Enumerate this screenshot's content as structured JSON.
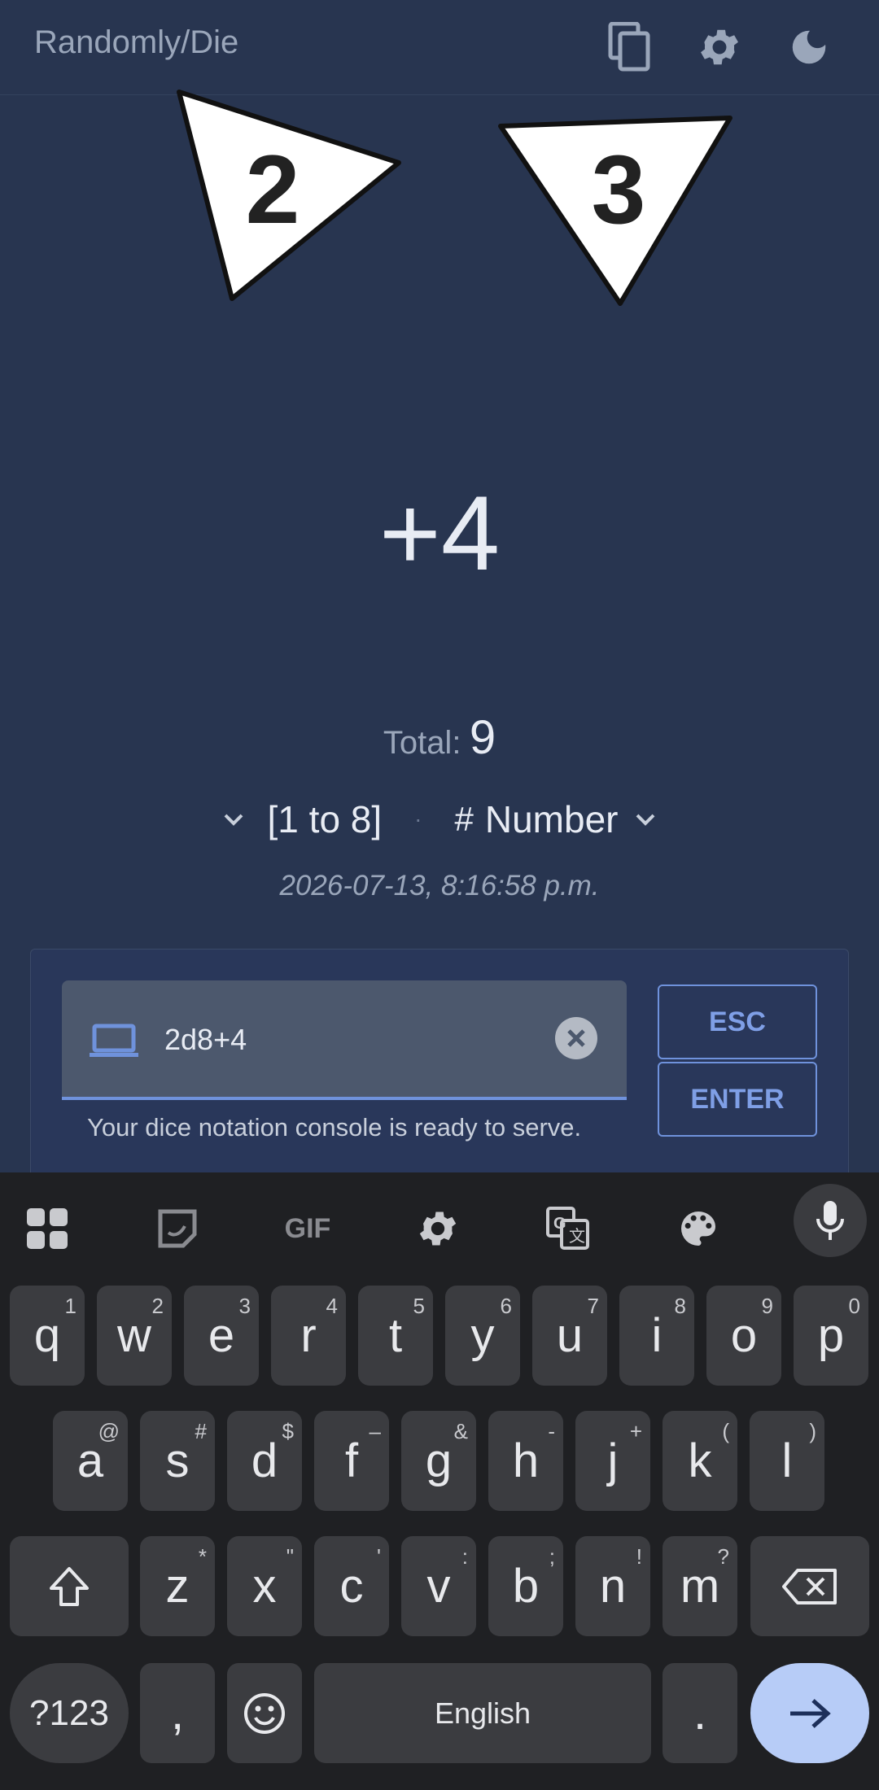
{
  "appbar": {
    "title": "Randomly/Die",
    "icons": [
      "copy-icon",
      "settings-icon",
      "dark-mode-icon"
    ]
  },
  "dice": [
    {
      "value": "2",
      "shape": "triangle-right"
    },
    {
      "value": "3",
      "shape": "triangle-down"
    }
  ],
  "result": "+4",
  "total": {
    "label": "Total:",
    "value": "9"
  },
  "options": {
    "range": "[1 to 8]",
    "separator": "·",
    "mode_icon": "#",
    "mode": "Number"
  },
  "timestamp": "2026-07-13, 8:16:58 p.m.",
  "console": {
    "input_value": "2d8+4",
    "helper": "Your dice notation console is ready to serve.",
    "esc_label": "ESC",
    "enter_label": "ENTER"
  },
  "keyboard": {
    "toolbar": [
      "apps-icon",
      "sticker-icon",
      "GIF",
      "settings-icon",
      "translate-icon",
      "palette-icon",
      "mic-icon"
    ],
    "row1": [
      {
        "k": "q",
        "s": "1"
      },
      {
        "k": "w",
        "s": "2"
      },
      {
        "k": "e",
        "s": "3"
      },
      {
        "k": "r",
        "s": "4"
      },
      {
        "k": "t",
        "s": "5"
      },
      {
        "k": "y",
        "s": "6"
      },
      {
        "k": "u",
        "s": "7"
      },
      {
        "k": "i",
        "s": "8"
      },
      {
        "k": "o",
        "s": "9"
      },
      {
        "k": "p",
        "s": "0"
      }
    ],
    "row2": [
      {
        "k": "a",
        "s": "@"
      },
      {
        "k": "s",
        "s": "#"
      },
      {
        "k": "d",
        "s": "$"
      },
      {
        "k": "f",
        "s": "–"
      },
      {
        "k": "g",
        "s": "&"
      },
      {
        "k": "h",
        "s": "-"
      },
      {
        "k": "j",
        "s": "+"
      },
      {
        "k": "k",
        "s": "("
      },
      {
        "k": "l",
        "s": ")"
      }
    ],
    "row3": [
      {
        "k": "z",
        "s": "*"
      },
      {
        "k": "x",
        "s": "\""
      },
      {
        "k": "c",
        "s": "'"
      },
      {
        "k": "v",
        "s": ":"
      },
      {
        "k": "b",
        "s": ";"
      },
      {
        "k": "n",
        "s": "!"
      },
      {
        "k": "m",
        "s": "?"
      }
    ],
    "sym_label": "?123",
    "comma": ",",
    "space_label": "English",
    "period": "."
  }
}
